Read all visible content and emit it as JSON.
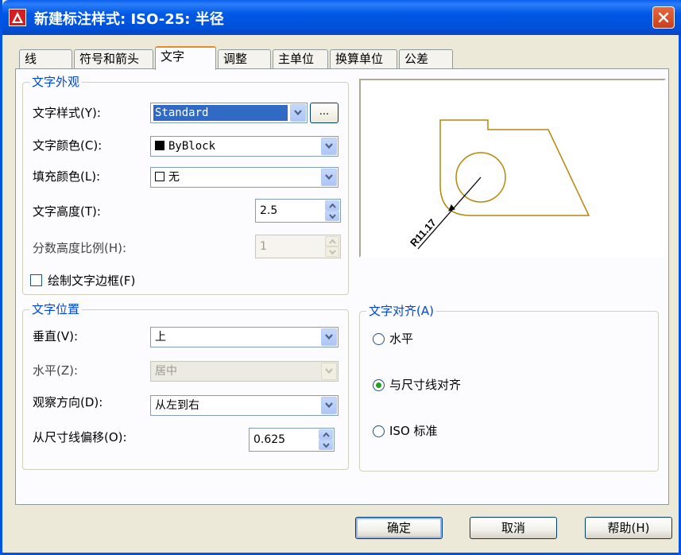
{
  "window": {
    "title": "新建标注样式: ISO-25: 半径"
  },
  "tabs": [
    {
      "label": "线",
      "active": false
    },
    {
      "label": "符号和箭头",
      "active": false
    },
    {
      "label": "文字",
      "active": true
    },
    {
      "label": "调整",
      "active": false
    },
    {
      "label": "主单位",
      "active": false
    },
    {
      "label": "换算单位",
      "active": false
    },
    {
      "label": "公差",
      "active": false
    }
  ],
  "text_appearance": {
    "title": "文字外观",
    "text_style": {
      "label": "文字样式(Y):",
      "value": "Standard",
      "browse_label": "..."
    },
    "text_color": {
      "label": "文字颜色(C):",
      "value": "ByBlock",
      "swatch": "#000000"
    },
    "fill_color": {
      "label": "填充颜色(L):",
      "value": "无",
      "swatch": "#ffffff"
    },
    "text_height": {
      "label": "文字高度(T):",
      "value": "2.5"
    },
    "fraction_scale": {
      "label": "分数高度比例(H):",
      "value": "1"
    },
    "draw_frame": {
      "label": "绘制文字边框(F)",
      "checked": false
    }
  },
  "text_placement": {
    "title": "文字位置",
    "vertical": {
      "label": "垂直(V):",
      "value": "上"
    },
    "horizontal": {
      "label": "水平(Z):",
      "value": "居中"
    },
    "view_direction": {
      "label": "观察方向(D):",
      "value": "从左到右"
    },
    "offset": {
      "label": "从尺寸线偏移(O):",
      "value": "0.625"
    }
  },
  "text_alignment": {
    "title": "文字对齐(A)",
    "options": [
      {
        "label": "水平",
        "checked": false
      },
      {
        "label": "与尺寸线对齐",
        "checked": true
      },
      {
        "label": "ISO 标准",
        "checked": false
      }
    ]
  },
  "preview": {
    "dimension_text": "R11.17",
    "line_color": "#b8860b"
  },
  "buttons": {
    "ok": "确定",
    "cancel": "取消",
    "help": "帮助(H)"
  }
}
